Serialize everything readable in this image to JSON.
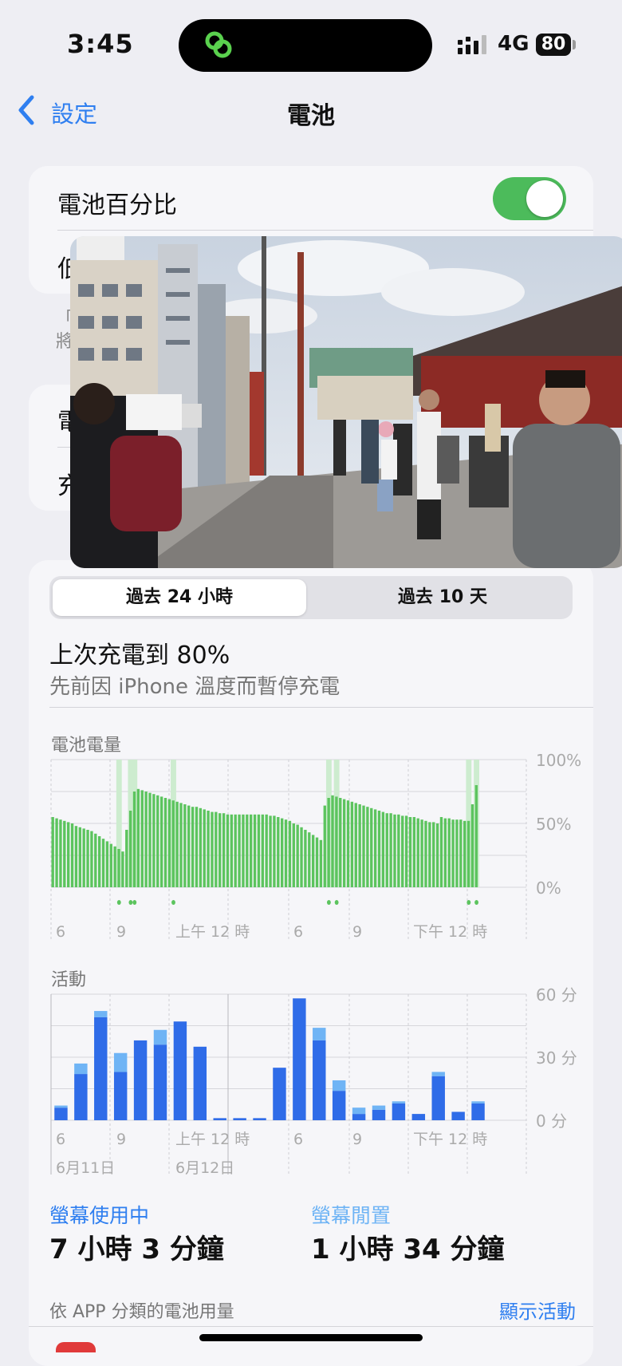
{
  "status_bar": {
    "time": "3:45",
    "network": "4G",
    "battery_level": "80"
  },
  "nav": {
    "back_label": "設定",
    "title": "電池"
  },
  "settings_card": {
    "row1_label": "電池百分比",
    "row1_toggle_on": true,
    "row2_label_partial": "低"
  },
  "partial_footer": {
    "line1": "「(",
    "line2": "將"
  },
  "settings_card2": {
    "row1_label_partial": "電",
    "row2_label_partial": "充"
  },
  "segmented": {
    "tab1": "過去 24 小時",
    "tab2": "過去 10 天",
    "selected": 0
  },
  "charge_info": {
    "title": "上次充電到 80%",
    "subtitle": "先前因 iPhone 溫度而暫停充電"
  },
  "battery_chart": {
    "label": "電池電量",
    "y_ticks": [
      "100%",
      "50%",
      "0%"
    ],
    "x_ticks": [
      "6",
      "9",
      "上午 12 時",
      "6",
      "9",
      "下午 12 時"
    ]
  },
  "activity_chart": {
    "label": "活動",
    "y_ticks": [
      "60 分",
      "30 分",
      "0 分"
    ],
    "x_ticks": [
      "6",
      "9",
      "上午 12 時",
      "6",
      "9",
      "下午 12 時"
    ],
    "dates": [
      "6月11日",
      "6月12日"
    ]
  },
  "chart_data": [
    {
      "type": "bar",
      "title": "電池電量",
      "ylabel": "",
      "ylim": [
        0,
        100
      ],
      "y_ticks": [
        "0%",
        "50%",
        "100%"
      ],
      "x_ticks": [
        "6",
        "9",
        "上午 12 時",
        "6",
        "9",
        "下午 12 時"
      ],
      "values": [
        55,
        54,
        53,
        52,
        51,
        50,
        48,
        47,
        46,
        45,
        44,
        42,
        40,
        38,
        36,
        34,
        32,
        30,
        28,
        45,
        60,
        75,
        77,
        76,
        75,
        74,
        73,
        72,
        71,
        70,
        69,
        68,
        67,
        66,
        65,
        64,
        63,
        63,
        62,
        61,
        60,
        59,
        59,
        58,
        58,
        57,
        57,
        57,
        57,
        57,
        57,
        57,
        57,
        57,
        57,
        57,
        56,
        56,
        55,
        54,
        53,
        52,
        50,
        49,
        47,
        45,
        43,
        41,
        39,
        37,
        64,
        70,
        72,
        71,
        70,
        69,
        68,
        67,
        66,
        65,
        64,
        63,
        62,
        61,
        60,
        59,
        58,
        58,
        57,
        57,
        56,
        56,
        55,
        55,
        54,
        53,
        52,
        51,
        51,
        50,
        55,
        54,
        54,
        53,
        53,
        53,
        52,
        52,
        65,
        80
      ],
      "charging_highlight_indices": [
        17,
        20,
        21,
        31,
        71,
        73,
        107,
        109
      ]
    },
    {
      "type": "bar",
      "title": "活動",
      "ylabel": "",
      "ylim": [
        0,
        60
      ],
      "y_ticks": [
        "0 分",
        "30 分",
        "60 分"
      ],
      "x_ticks": [
        "6",
        "9",
        "上午 12 時",
        "6",
        "9",
        "下午 12 時"
      ],
      "series": [
        {
          "name": "螢幕使用中",
          "values": [
            6,
            22,
            49,
            23,
            38,
            36,
            47,
            35,
            1,
            1,
            1,
            25,
            58,
            38,
            14,
            3,
            5,
            8,
            3,
            21,
            4,
            8
          ]
        },
        {
          "name": "螢幕閒置",
          "values": [
            1,
            5,
            3,
            9,
            0,
            7,
            0,
            0,
            0,
            0,
            0,
            0,
            0,
            6,
            5,
            3,
            2,
            1,
            0,
            2,
            0,
            1
          ]
        }
      ]
    }
  ],
  "usage_summary": {
    "screen_on_label": "螢幕使用中",
    "screen_on_value": "7 小時 3 分鐘",
    "screen_idle_label": "螢幕閒置",
    "screen_idle_value": "1 小時 34 分鐘"
  },
  "app_usage": {
    "label": "依 APP 分類的電池用量",
    "action": "顯示活動"
  },
  "colors": {
    "accent": "#2f7ff0",
    "battery_green": "#5cc45e",
    "activity_blue": "#2f6ce8",
    "idle_blue": "#6fb4f5",
    "toggle_green": "#4cbb5b"
  }
}
